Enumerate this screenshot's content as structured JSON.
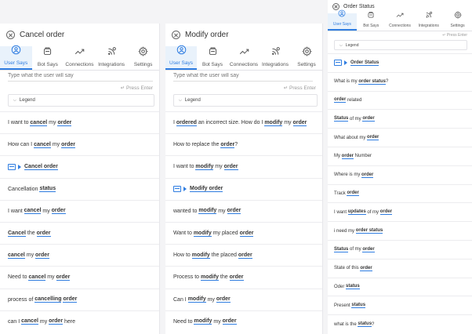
{
  "tabs": [
    {
      "label": "User Says",
      "icon": "user-icon",
      "active": true
    },
    {
      "label": "Bot Says",
      "icon": "bot-icon",
      "active": false
    },
    {
      "label": "Connections",
      "icon": "connections-icon",
      "active": false
    },
    {
      "label": "Integrations",
      "icon": "integrations-icon",
      "active": false
    },
    {
      "label": "Settings",
      "icon": "gear-icon",
      "active": false
    }
  ],
  "input_placeholder": "Type what the user will say",
  "press_enter": "Press Enter",
  "legend": "Legend",
  "accent_color": "#2f7de1",
  "panels": [
    {
      "title": "Cancel order",
      "rows": [
        {
          "type": "utterance",
          "parts": [
            [
              "I want to ",
              false
            ],
            [
              "cancel",
              true
            ],
            [
              " my ",
              false
            ],
            [
              "order",
              true
            ]
          ]
        },
        {
          "type": "utterance",
          "parts": [
            [
              "How can I ",
              false
            ],
            [
              "cancel",
              true
            ],
            [
              " my ",
              false
            ],
            [
              "order",
              true
            ]
          ]
        },
        {
          "type": "intent",
          "parts": [
            [
              "Cancel order",
              true
            ]
          ]
        },
        {
          "type": "utterance",
          "parts": [
            [
              "Cancellation ",
              false
            ],
            [
              "status",
              true
            ]
          ]
        },
        {
          "type": "utterance",
          "parts": [
            [
              "I want ",
              false
            ],
            [
              "cancel",
              true
            ],
            [
              " my ",
              false
            ],
            [
              "order",
              true
            ]
          ]
        },
        {
          "type": "utterance",
          "parts": [
            [
              "Cancel",
              true
            ],
            [
              " the ",
              false
            ],
            [
              "order",
              true
            ]
          ]
        },
        {
          "type": "utterance",
          "parts": [
            [
              "cancel",
              true
            ],
            [
              " my ",
              false
            ],
            [
              "order",
              true
            ]
          ]
        },
        {
          "type": "utterance",
          "parts": [
            [
              "Need to ",
              false
            ],
            [
              "cancel",
              true
            ],
            [
              " my ",
              false
            ],
            [
              "order",
              true
            ]
          ]
        },
        {
          "type": "utterance",
          "parts": [
            [
              "process of ",
              false
            ],
            [
              "cancelling",
              true
            ],
            [
              " ",
              false
            ],
            [
              "order",
              true
            ]
          ]
        },
        {
          "type": "utterance",
          "parts": [
            [
              "can I ",
              false
            ],
            [
              "cancel",
              true
            ],
            [
              " my ",
              false
            ],
            [
              "order",
              true
            ],
            [
              " here",
              false
            ]
          ]
        }
      ]
    },
    {
      "title": "Modify order",
      "rows": [
        {
          "type": "utterance",
          "parts": [
            [
              "I ",
              false
            ],
            [
              "ordered",
              true
            ],
            [
              " an incorrect size. How do I ",
              false
            ],
            [
              "modify",
              true
            ],
            [
              " my ",
              false
            ],
            [
              "order",
              true
            ]
          ]
        },
        {
          "type": "utterance",
          "parts": [
            [
              "How to replace the ",
              false
            ],
            [
              "order",
              true
            ],
            [
              "?",
              false
            ]
          ]
        },
        {
          "type": "utterance",
          "parts": [
            [
              "I want to ",
              false
            ],
            [
              "modify",
              true
            ],
            [
              " my ",
              false
            ],
            [
              "order",
              true
            ]
          ]
        },
        {
          "type": "intent",
          "parts": [
            [
              "Modify order",
              true
            ]
          ]
        },
        {
          "type": "utterance",
          "parts": [
            [
              "wanted to ",
              false
            ],
            [
              "modify",
              true
            ],
            [
              " my ",
              false
            ],
            [
              "order",
              true
            ]
          ]
        },
        {
          "type": "utterance",
          "parts": [
            [
              "Want to ",
              false
            ],
            [
              "modify",
              true
            ],
            [
              " my placed ",
              false
            ],
            [
              "order",
              true
            ]
          ]
        },
        {
          "type": "utterance",
          "parts": [
            [
              "How to ",
              false
            ],
            [
              "modify",
              true
            ],
            [
              " the placed ",
              false
            ],
            [
              "order",
              true
            ]
          ]
        },
        {
          "type": "utterance",
          "parts": [
            [
              "Process to ",
              false
            ],
            [
              "modify",
              true
            ],
            [
              " the ",
              false
            ],
            [
              "order",
              true
            ]
          ]
        },
        {
          "type": "utterance",
          "parts": [
            [
              "Can I ",
              false
            ],
            [
              "modify",
              true
            ],
            [
              " my ",
              false
            ],
            [
              "order",
              true
            ]
          ]
        },
        {
          "type": "utterance",
          "parts": [
            [
              "Need to ",
              false
            ],
            [
              "modify",
              true
            ],
            [
              " my ",
              false
            ],
            [
              "order",
              true
            ]
          ]
        }
      ]
    },
    {
      "title": "Order Status",
      "rows": [
        {
          "type": "intent",
          "parts": [
            [
              "Order Status",
              true
            ]
          ]
        },
        {
          "type": "utterance",
          "parts": [
            [
              "What is my ",
              false
            ],
            [
              "order status",
              true
            ],
            [
              "?",
              false
            ]
          ]
        },
        {
          "type": "utterance",
          "parts": [
            [
              "order",
              true
            ],
            [
              " related",
              false
            ]
          ]
        },
        {
          "type": "utterance",
          "parts": [
            [
              "Status",
              true
            ],
            [
              " of my ",
              false
            ],
            [
              "order",
              true
            ]
          ]
        },
        {
          "type": "utterance",
          "parts": [
            [
              "What about my ",
              false
            ],
            [
              "order",
              true
            ]
          ]
        },
        {
          "type": "utterance",
          "parts": [
            [
              "My ",
              false
            ],
            [
              "order",
              true
            ],
            [
              " Number",
              false
            ]
          ]
        },
        {
          "type": "utterance",
          "parts": [
            [
              "Where is my ",
              false
            ],
            [
              "order",
              true
            ]
          ]
        },
        {
          "type": "utterance",
          "parts": [
            [
              "Track ",
              false
            ],
            [
              "order",
              true
            ]
          ]
        },
        {
          "type": "utterance",
          "parts": [
            [
              "I want ",
              false
            ],
            [
              "updates",
              true
            ],
            [
              " of my ",
              false
            ],
            [
              "order",
              true
            ]
          ]
        },
        {
          "type": "utterance",
          "parts": [
            [
              "i need my ",
              false
            ],
            [
              "order status",
              true
            ]
          ]
        },
        {
          "type": "utterance",
          "parts": [
            [
              "Status",
              true
            ],
            [
              " of my ",
              false
            ],
            [
              "order",
              true
            ]
          ]
        },
        {
          "type": "utterance",
          "parts": [
            [
              "State of this ",
              false
            ],
            [
              "order",
              true
            ]
          ]
        },
        {
          "type": "utterance",
          "parts": [
            [
              "Oder ",
              false
            ],
            [
              "status",
              true
            ]
          ]
        },
        {
          "type": "utterance",
          "parts": [
            [
              "Present ",
              false
            ],
            [
              "status",
              true
            ]
          ]
        },
        {
          "type": "utterance",
          "parts": [
            [
              "what is the ",
              false
            ],
            [
              "status",
              true
            ],
            [
              "?",
              false
            ]
          ]
        }
      ]
    }
  ]
}
